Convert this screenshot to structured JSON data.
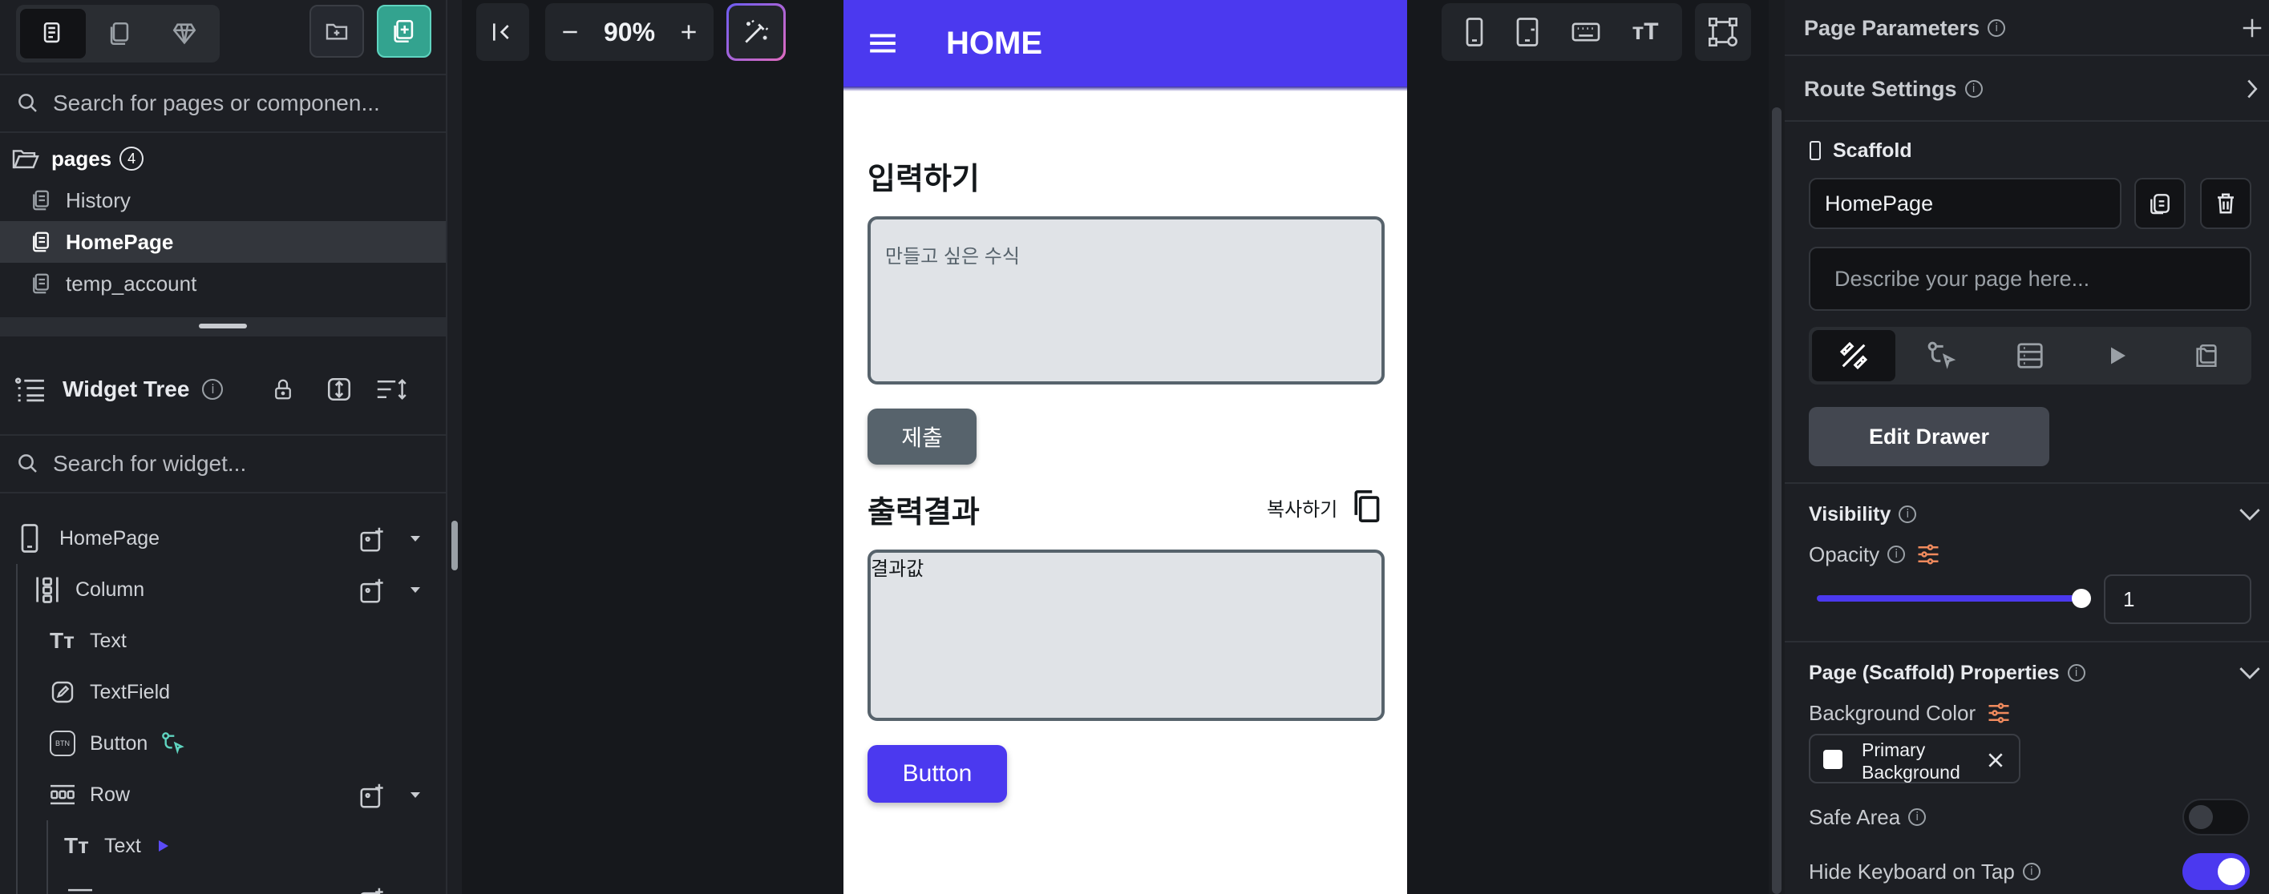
{
  "left_panel": {
    "search_pages_placeholder": "Search for pages or componen...",
    "pages_folder_label": "pages",
    "pages_count": "4",
    "pages": [
      {
        "label": "History",
        "selected": false
      },
      {
        "label": "HomePage",
        "selected": true
      },
      {
        "label": "temp_account",
        "selected": false
      }
    ],
    "widget_tree_title": "Widget Tree",
    "search_widget_placeholder": "Search for widget...",
    "tree": [
      {
        "label": "HomePage",
        "icon": "phone-icon"
      },
      {
        "label": "Column",
        "icon": "column-icon"
      },
      {
        "label": "Text",
        "icon": "text-icon"
      },
      {
        "label": "TextField",
        "icon": "textfield-icon"
      },
      {
        "label": "Button",
        "icon": "button-icon"
      },
      {
        "label": "Row",
        "icon": "row-icon"
      },
      {
        "label": "Text",
        "icon": "text-icon"
      }
    ]
  },
  "toolbar": {
    "zoom_level": "90%"
  },
  "phone": {
    "appbar_title": "HOME",
    "input_heading": "입력하기",
    "input_placeholder": "만들고 싶은 수식",
    "submit_button": "제출",
    "output_heading": "출력결과",
    "copy_label": "복사하기",
    "output_value": "결과값",
    "bottom_button": "Button"
  },
  "right_panel": {
    "page_parameters": "Page Parameters",
    "route_settings": "Route Settings",
    "scaffold_label": "Scaffold",
    "page_name_value": "HomePage",
    "description_placeholder": "Describe your page here...",
    "edit_drawer": "Edit Drawer",
    "visibility": "Visibility",
    "opacity_label": "Opacity",
    "opacity_value": "1",
    "scaffold_props": "Page (Scaffold) Properties",
    "background_color_label": "Background Color",
    "bg_chip_line1": "Primary",
    "bg_chip_line2": "Background",
    "safe_area": "Safe Area",
    "hide_keyboard": "Hide Keyboard on Tap"
  },
  "colors": {
    "accent": "#4b39ef",
    "teal": "#33a38f",
    "gray_button": "#57636c"
  }
}
